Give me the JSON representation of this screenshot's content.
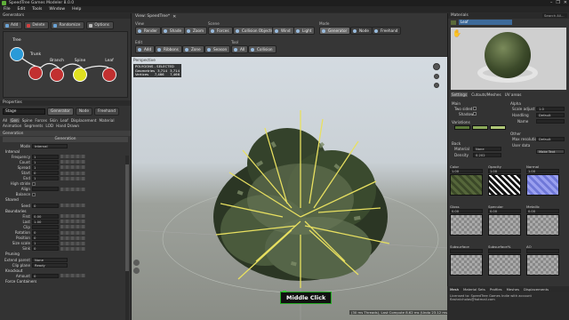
{
  "window": {
    "title": "SpeedTree Games Modeler 8.0.0",
    "controls": [
      "–",
      "❐",
      "✕"
    ]
  },
  "menu": [
    "File",
    "Edit",
    "Tools",
    "Window",
    "Help"
  ],
  "generators": {
    "header": "Generators",
    "toolbar": [
      "Add",
      "Delete",
      "Randomize",
      "Options"
    ],
    "nodes": [
      "Tree",
      "Trunk",
      "Branch",
      "Spine",
      "Leaf"
    ]
  },
  "properties": {
    "header": "Properties",
    "object_name": "Stage",
    "mode_buttons": [
      "Generator",
      "Node",
      "Freehand"
    ],
    "tabs": [
      "All",
      "Gen",
      "Spine",
      "Forces",
      "Skin",
      "Leaf",
      "Displacement",
      "Material",
      "Animation",
      "Segments",
      "LOD",
      "Hand Drawn"
    ],
    "selected_tab": "Gen",
    "section": "Generation",
    "group_title": "Generation",
    "rows": [
      {
        "label": "Mode",
        "value": "Interval",
        "kind": "drop"
      },
      {
        "label": "Interval",
        "kind": "section"
      },
      {
        "label": "Frequency",
        "value": "1",
        "kind": "field"
      },
      {
        "label": "Count",
        "value": "1",
        "kind": "field"
      },
      {
        "label": "Spread",
        "value": "1",
        "kind": "field"
      },
      {
        "label": "Start",
        "value": "0",
        "kind": "field"
      },
      {
        "label": "End",
        "value": "1",
        "kind": "field"
      },
      {
        "label": "High stride",
        "value": "",
        "kind": "check"
      },
      {
        "label": "Align",
        "value": "",
        "kind": "field"
      },
      {
        "label": "Balance",
        "value": "",
        "kind": "check"
      },
      {
        "label": "Shared",
        "kind": "section"
      },
      {
        "label": "Seed",
        "value": "0",
        "kind": "field"
      },
      {
        "label": "Boundaries",
        "kind": "section"
      },
      {
        "label": "First",
        "value": "0.00",
        "kind": "field"
      },
      {
        "label": "Last",
        "value": "1.00",
        "kind": "field"
      },
      {
        "label": "Clip",
        "value": "",
        "kind": "field"
      },
      {
        "label": "Rotation",
        "value": "0",
        "kind": "field"
      },
      {
        "label": "Position",
        "value": "0",
        "kind": "field"
      },
      {
        "label": "Size scale",
        "value": "1",
        "kind": "field"
      },
      {
        "label": "Sink",
        "value": "0",
        "kind": "field"
      },
      {
        "label": "Pruning",
        "kind": "section"
      },
      {
        "label": "Extend parent",
        "value": "None",
        "kind": "drop"
      },
      {
        "label": "Clip plane",
        "value": "Ready",
        "kind": "drop"
      },
      {
        "label": "Knockout",
        "kind": "section"
      },
      {
        "label": "Amount",
        "value": "0",
        "kind": "field"
      },
      {
        "label": "Force Containers",
        "kind": "section"
      }
    ]
  },
  "view": {
    "tab_label": "View: SpeedTree*",
    "tab_close": "✕",
    "groups": {
      "view": "View",
      "scene": "Scene",
      "mode": "Mode",
      "edit": "Edit",
      "tool": "Tool"
    },
    "view_tools": [
      "Render",
      "Shade",
      "Zoom"
    ],
    "scene_tools": [
      "Forces",
      "Collision Objects",
      "Wind",
      "Light"
    ],
    "mode_tools": [
      "Generator",
      "Node",
      "Freehand"
    ],
    "edit_tools": [
      "Add",
      "Ribbons",
      "Zone",
      "Season"
    ],
    "tool_tools": [
      "All",
      "Collision"
    ],
    "viewport_label": "Perspective",
    "stats": {
      "title": "POLYGONS - SELECTED",
      "rows": [
        [
          "Geometries",
          "3,714",
          "3,714"
        ],
        [
          "Vertices",
          "7,466",
          "7,466"
        ]
      ]
    }
  },
  "overlay": {
    "mouse": "Middle Click",
    "status": "(30 ms Threads), Last Compute 8.62 ms (Undo 23.12 ms)"
  },
  "materials": {
    "header": "Materials",
    "search_placeholder": "Search All...",
    "selected": "Leaf",
    "tabs": [
      "Settings",
      "Cutouts/Meshes",
      "UV areas"
    ],
    "settings": {
      "main": "Main",
      "two_sided": "Two sided",
      "shadows": "Shadows",
      "variations": "Variations",
      "back": "Back",
      "material": "Material",
      "material_value": "None",
      "density": "Density",
      "density_value": "0.202",
      "alpha": "Alpha",
      "scale_adjust": "Scale adjust",
      "scale_value": "1.0",
      "handling": "Handling",
      "handling_value": "Default",
      "name": "Name",
      "other": "Other",
      "max_resolution": "Max resolution",
      "max_resolution_value": "Default",
      "user_data": "User data",
      "user_data_btn": "Make Text"
    },
    "maps": [
      {
        "label": "Color",
        "value": "1.00",
        "thumb": "leaf"
      },
      {
        "label": "Opacity",
        "value": "1.00",
        "thumb": "bw"
      },
      {
        "label": "Normal",
        "value": "1.00",
        "thumb": "norm"
      },
      {
        "label": "Gloss",
        "value": "0.00",
        "thumb": "check"
      },
      {
        "label": "Specular",
        "value": "0.00",
        "thumb": "check"
      },
      {
        "label": "Metallic",
        "value": "0.00",
        "thumb": "check"
      },
      {
        "label": "Subsurface",
        "value": "",
        "thumb": "check"
      },
      {
        "label": "Subsurface%",
        "value": "",
        "thumb": "check"
      },
      {
        "label": "AO",
        "value": "",
        "thumb": "check"
      }
    ],
    "bottom_tabs": [
      "Mesh",
      "Material Sets",
      "Profiles",
      "Meshes",
      "Displacements"
    ],
    "bottom_selected": "Mesh",
    "log": "Licensed to: SpeedTree Games Indie with account flashnicholas@hotmail.com"
  },
  "colors": {
    "accent": "#3d6a9a",
    "generator_spine": "#e0e020",
    "generator_node": "#c23030",
    "tree_node": "#2a9ad8"
  }
}
